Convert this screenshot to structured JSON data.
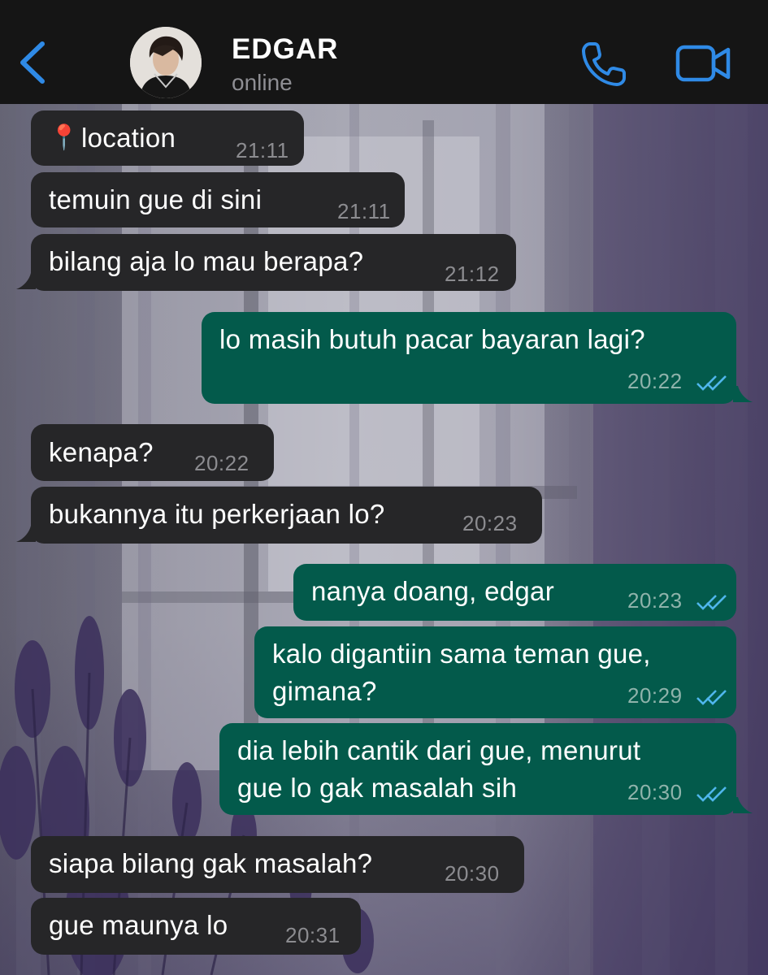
{
  "header": {
    "contact_name": "EDGAR",
    "status": "online",
    "back_icon": "chevron-left-icon",
    "call_icon": "phone-icon",
    "video_icon": "video-camera-icon",
    "accent_color": "#2f8ae6"
  },
  "messages": [
    {
      "direction": "incoming",
      "pin": "📍",
      "text": "location",
      "time": "21:11"
    },
    {
      "direction": "incoming",
      "text": "temuin gue di sini",
      "time": "21:11"
    },
    {
      "direction": "incoming",
      "text": "bilang aja lo mau berapa?",
      "time": "21:12"
    },
    {
      "direction": "outgoing",
      "text": "lo masih butuh pacar bayaran lagi?",
      "time": "20:22",
      "status": "read"
    },
    {
      "direction": "incoming",
      "text": "kenapa?",
      "time": "20:22"
    },
    {
      "direction": "incoming",
      "text": "bukannya itu perkerjaan lo?",
      "time": "20:23"
    },
    {
      "direction": "outgoing",
      "text": "nanya doang, edgar",
      "time": "20:23",
      "status": "read"
    },
    {
      "direction": "outgoing",
      "text": "kalo digantiin sama teman gue,\ngimana?",
      "time": "20:29",
      "status": "read"
    },
    {
      "direction": "outgoing",
      "text": "dia lebih cantik dari gue, menurut\ngue lo gak masalah sih",
      "time": "20:30",
      "status": "read"
    },
    {
      "direction": "incoming",
      "text": "siapa bilang gak masalah?",
      "time": "20:30"
    },
    {
      "direction": "incoming",
      "text": "gue maunya lo",
      "time": "20:31"
    }
  ],
  "colors": {
    "incoming_bubble": "#262628",
    "outgoing_bubble": "#035a4b",
    "read_ticks": "#4fb6ec"
  }
}
